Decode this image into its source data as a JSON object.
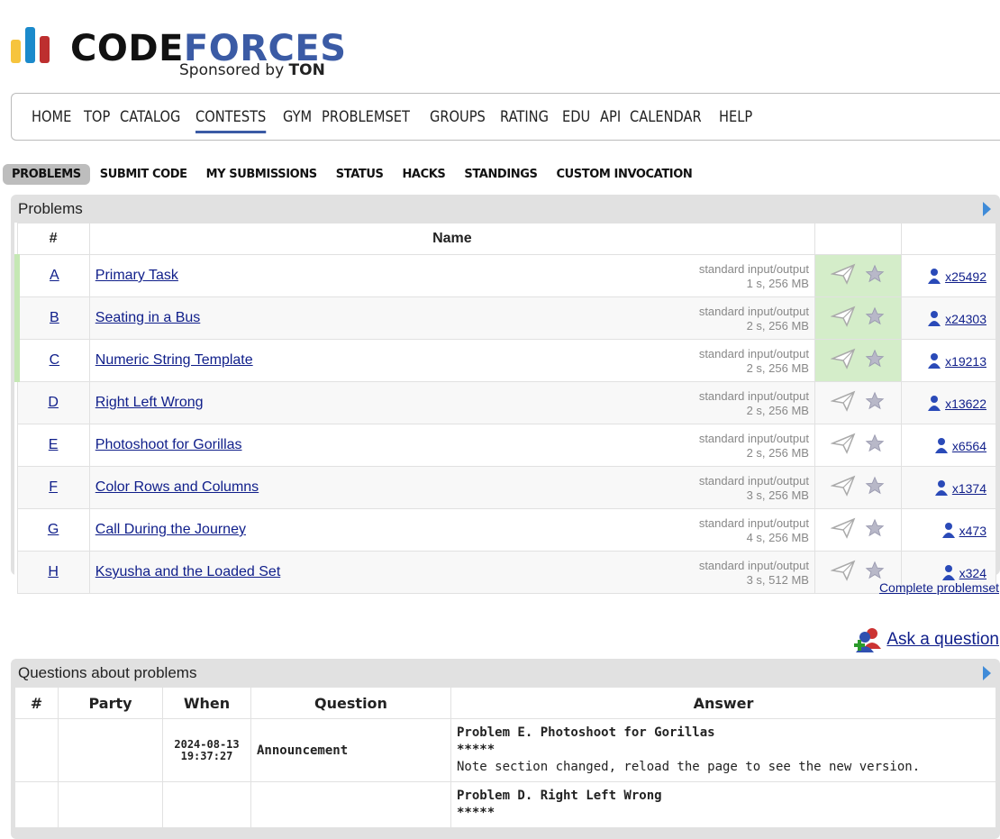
{
  "brand": {
    "word_part1": "CODE",
    "word_part2": "FORCES",
    "sponsor_text": "Sponsored by",
    "sponsor_name": "TON",
    "colors": {
      "yellow": "#f6c43d",
      "blue": "#1b8acb",
      "red": "#bd2f2f",
      "accent": "#3b5ba5"
    }
  },
  "main_nav": {
    "items": [
      "HOME",
      "TOP",
      "CATALOG",
      "CONTESTS",
      "GYM",
      "PROBLEMSET",
      "GROUPS",
      "RATING",
      "EDU",
      "API",
      "CALENDAR",
      "HELP"
    ],
    "active": "CONTESTS"
  },
  "sub_nav": {
    "items": [
      "PROBLEMS",
      "SUBMIT CODE",
      "MY SUBMISSIONS",
      "STATUS",
      "HACKS",
      "STANDINGS",
      "CUSTOM INVOCATION"
    ],
    "active": "PROBLEMS"
  },
  "problems_box": {
    "caption": "Problems",
    "headers": {
      "index": "#",
      "name": "Name"
    },
    "rows": [
      {
        "index": "A",
        "name": "Primary Task",
        "io": "standard input/output",
        "limits": "1 s, 256 MB",
        "solved": "x25492",
        "accepted": true
      },
      {
        "index": "B",
        "name": "Seating in a Bus",
        "io": "standard input/output",
        "limits": "2 s, 256 MB",
        "solved": "x24303",
        "accepted": true
      },
      {
        "index": "C",
        "name": "Numeric String Template",
        "io": "standard input/output",
        "limits": "2 s, 256 MB",
        "solved": "x19213",
        "accepted": true
      },
      {
        "index": "D",
        "name": "Right Left Wrong",
        "io": "standard input/output",
        "limits": "2 s, 256 MB",
        "solved": "x13622",
        "accepted": false
      },
      {
        "index": "E",
        "name": "Photoshoot for Gorillas",
        "io": "standard input/output",
        "limits": "2 s, 256 MB",
        "solved": "x6564",
        "accepted": false
      },
      {
        "index": "F",
        "name": "Color Rows and Columns",
        "io": "standard input/output",
        "limits": "3 s, 256 MB",
        "solved": "x1374",
        "accepted": false
      },
      {
        "index": "G",
        "name": "Call During the Journey",
        "io": "standard input/output",
        "limits": "4 s, 256 MB",
        "solved": "x473",
        "accepted": false
      },
      {
        "index": "H",
        "name": "Ksyusha and the Loaded Set",
        "io": "standard input/output",
        "limits": "3 s, 512 MB",
        "solved": "x324",
        "accepted": false
      }
    ]
  },
  "complete_link": "Complete problemset",
  "ask_link": "Ask a question",
  "questions_box": {
    "caption": "Questions about problems",
    "headers": {
      "index": "#",
      "party": "Party",
      "when": "When",
      "question": "Question",
      "answer": "Answer"
    },
    "rows": [
      {
        "date": "2024-08-13",
        "time": "19:37:27",
        "question": "Announcement",
        "answer_title": "Problem E. Photoshoot for Gorillas",
        "answer_sep": "*****",
        "answer_text": "Note section changed, reload the page to see the new version."
      },
      {
        "date": "",
        "time": "",
        "question": "",
        "answer_title": "Problem D. Right Left Wrong",
        "answer_sep": "*****",
        "answer_text": ""
      }
    ]
  }
}
